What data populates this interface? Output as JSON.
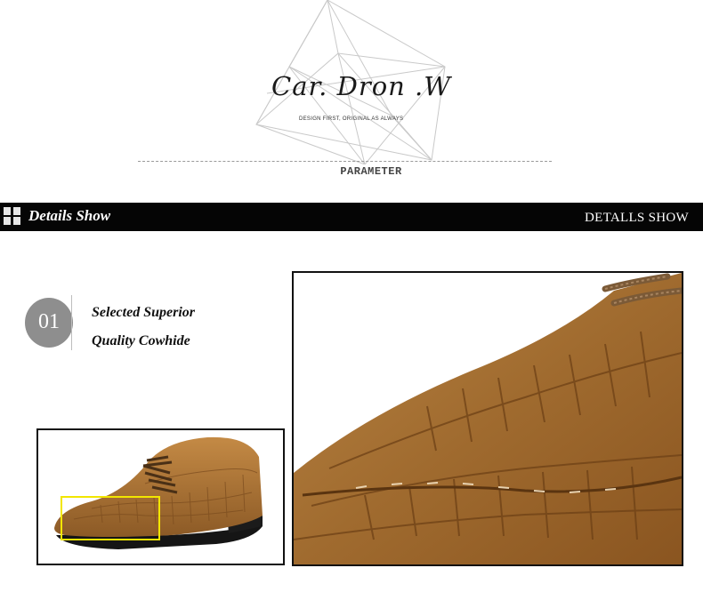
{
  "brand": {
    "name": "Car. Dron .W",
    "tagline": "DESIGN FIRST, ORIGINAL AS ALWAYS",
    "section_label": "PARAMETER"
  },
  "details_bar": {
    "title": "Details Show",
    "right_label": "DETALLS SHOW"
  },
  "feature": {
    "number": "01",
    "line1": "Selected Superior",
    "line2": "Quality Cowhide"
  },
  "colors": {
    "bar": "#050505",
    "badge": "#8e8e8e",
    "leather": "#b07a3a",
    "highlight": "#f2e600"
  }
}
